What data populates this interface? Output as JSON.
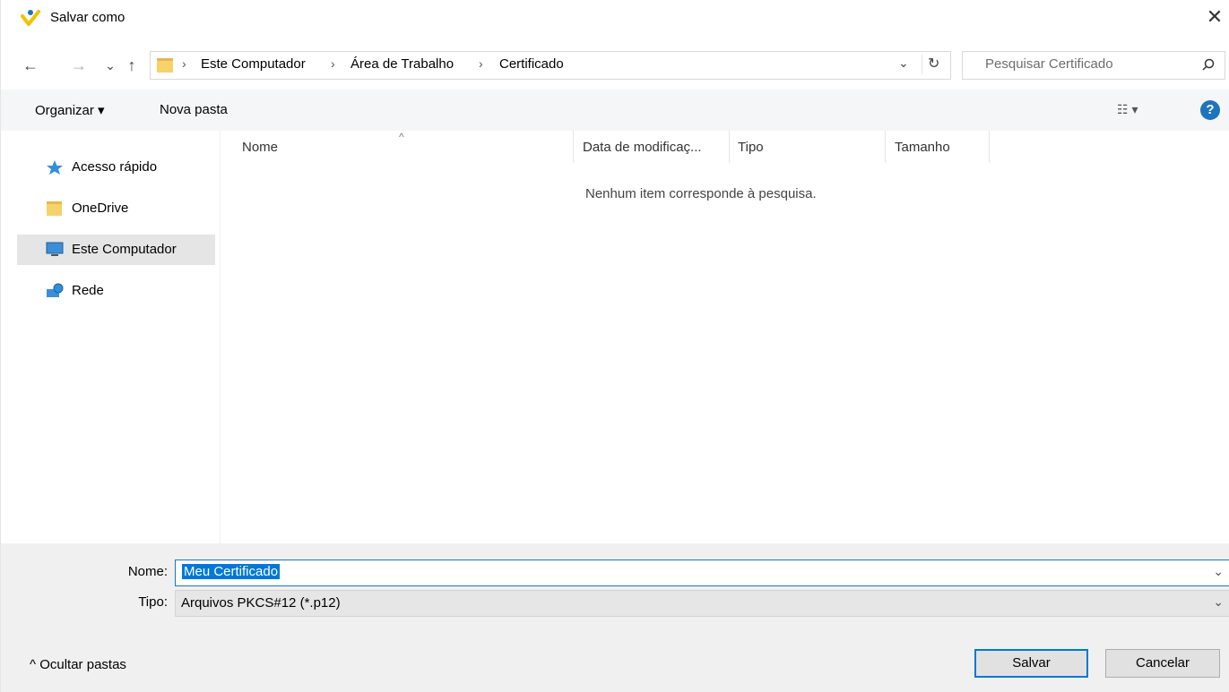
{
  "window": {
    "title": "Salvar como",
    "close_symbol": "✕"
  },
  "nav": {
    "back_symbol": "←",
    "forward_symbol": "→",
    "recent_symbol": "⌄",
    "up_symbol": "↑",
    "breadcrumb": [
      "Este Computador",
      "Área de Trabalho",
      "Certificado"
    ],
    "separator": "›",
    "dropdown_symbol": "⌄",
    "refresh_symbol": "↻",
    "search_placeholder": "Pesquisar Certificado"
  },
  "toolbar": {
    "organize_label": "Organizar ▾",
    "new_folder_label": "Nova pasta",
    "view_symbol": "☷ ▾",
    "help_symbol": "?"
  },
  "sidebar": {
    "items": [
      {
        "label": "Acesso rápido",
        "icon": "star-icon"
      },
      {
        "label": "OneDrive",
        "icon": "folder-icon"
      },
      {
        "label": "Este Computador",
        "icon": "computer-icon",
        "selected": true
      },
      {
        "label": "Rede",
        "icon": "network-icon"
      }
    ]
  },
  "file_list": {
    "sort_symbol": "^",
    "columns": [
      "Nome",
      "Data de modificaç...",
      "Tipo",
      "Tamanho"
    ],
    "empty_message": "Nenhum item corresponde à pesquisa."
  },
  "form": {
    "name_label": "Nome:",
    "name_value": "Meu Certificado",
    "type_label": "Tipo:",
    "type_value": "Arquivos PKCS#12 (*.p12)",
    "dropdown_symbol": "⌄",
    "hide_folders_label": "^  Ocultar pastas",
    "save_label": "Salvar",
    "cancel_label": "Cancelar"
  },
  "colors": {
    "accent": "#0078d7",
    "selection_bg": "#e5e5e5",
    "footer_bg": "#f0f0f0"
  }
}
